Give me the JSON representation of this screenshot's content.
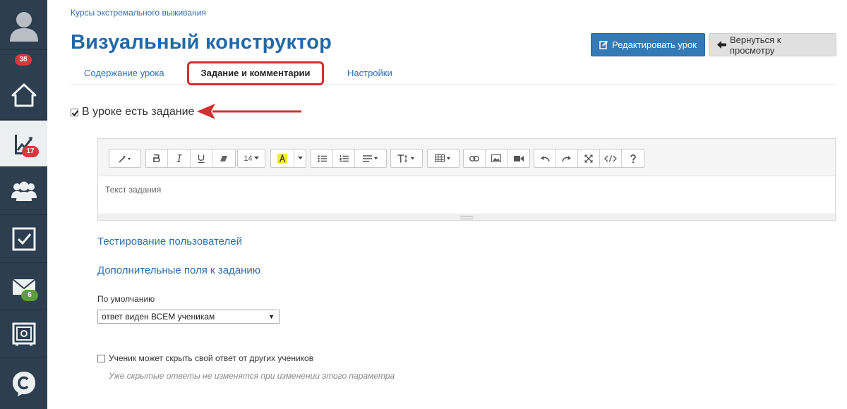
{
  "sidebar": {
    "badges": {
      "notifications": "38",
      "stats": "17",
      "messages": "6"
    },
    "items": [
      {
        "icon": "user-avatar-icon"
      },
      {
        "icon": "home-icon"
      },
      {
        "icon": "chart-icon"
      },
      {
        "icon": "users-icon"
      },
      {
        "icon": "checkbox-icon"
      },
      {
        "icon": "mail-icon"
      },
      {
        "icon": "safe-icon"
      },
      {
        "icon": "chat-logo-icon"
      }
    ]
  },
  "breadcrumb": "Курсы экстремального выживания",
  "page_title": "Визуальный конструктор",
  "header_buttons": {
    "edit_lesson": "Редактировать урок",
    "back_to_view": "Вернуться к просмотру"
  },
  "tabs": [
    {
      "label": "Содержание урока"
    },
    {
      "label": "Задание и комментарии"
    },
    {
      "label": "Настройки"
    }
  ],
  "task": {
    "has_task_label": "В уроке есть задание",
    "has_task_checked": true
  },
  "editor": {
    "font_size": "14",
    "placeholder": "Текст задания"
  },
  "sections": {
    "testing": "Тестирование пользователей",
    "extra_fields": "Дополнительные поля к заданию"
  },
  "visibility": {
    "label": "По умолчанию",
    "selected": "ответ виден ВСЕМ ученикам"
  },
  "hide_answer": {
    "label": "Ученик может скрыть свой ответ от других учеников",
    "hint": "Уже скрытые ответы не изменятся при изменении этого параметра",
    "checked": false
  },
  "colors": {
    "sidebar_bg": "#2c3e50",
    "primary": "#337ab7",
    "title": "#2069ab",
    "highlight": "#d32f2f"
  }
}
